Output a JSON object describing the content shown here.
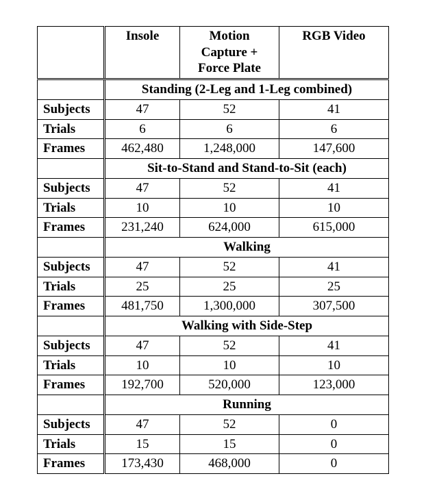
{
  "columns": {
    "blank": "",
    "insole": "Insole",
    "mocap_line1": "Motion",
    "mocap_line2": "Capture +",
    "mocap_line3": "Force Plate",
    "rgb": "RGB Video"
  },
  "row_labels": {
    "subjects": "Subjects",
    "trials": "Trials",
    "frames": "Frames"
  },
  "chart_data": {
    "type": "table",
    "column_headers": [
      "",
      "Insole",
      "Motion Capture + Force Plate",
      "RGB Video"
    ],
    "sections": [
      {
        "title": "Standing (2-Leg and 1-Leg combined)",
        "rows": [
          {
            "label": "Subjects",
            "values": [
              "47",
              "52",
              "41"
            ]
          },
          {
            "label": "Trials",
            "values": [
              "6",
              "6",
              "6"
            ]
          },
          {
            "label": "Frames",
            "values": [
              "462,480",
              "1,248,000",
              "147,600"
            ]
          }
        ]
      },
      {
        "title": "Sit-to-Stand and Stand-to-Sit (each)",
        "rows": [
          {
            "label": "Subjects",
            "values": [
              "47",
              "52",
              "41"
            ]
          },
          {
            "label": "Trials",
            "values": [
              "10",
              "10",
              "10"
            ]
          },
          {
            "label": "Frames",
            "values": [
              "231,240",
              "624,000",
              "615,000"
            ]
          }
        ]
      },
      {
        "title": "Walking",
        "rows": [
          {
            "label": "Subjects",
            "values": [
              "47",
              "52",
              "41"
            ]
          },
          {
            "label": "Trials",
            "values": [
              "25",
              "25",
              "25"
            ]
          },
          {
            "label": "Frames",
            "values": [
              "481,750",
              "1,300,000",
              "307,500"
            ]
          }
        ]
      },
      {
        "title": "Walking with Side-Step",
        "rows": [
          {
            "label": "Subjects",
            "values": [
              "47",
              "52",
              "41"
            ]
          },
          {
            "label": "Trials",
            "values": [
              "10",
              "10",
              "10"
            ]
          },
          {
            "label": "Frames",
            "values": [
              "192,700",
              "520,000",
              "123,000"
            ]
          }
        ]
      },
      {
        "title": "Running",
        "rows": [
          {
            "label": "Subjects",
            "values": [
              "47",
              "52",
              "0"
            ]
          },
          {
            "label": "Trials",
            "values": [
              "15",
              "15",
              "0"
            ]
          },
          {
            "label": "Frames",
            "values": [
              "173,430",
              "468,000",
              "0"
            ]
          }
        ]
      }
    ]
  }
}
